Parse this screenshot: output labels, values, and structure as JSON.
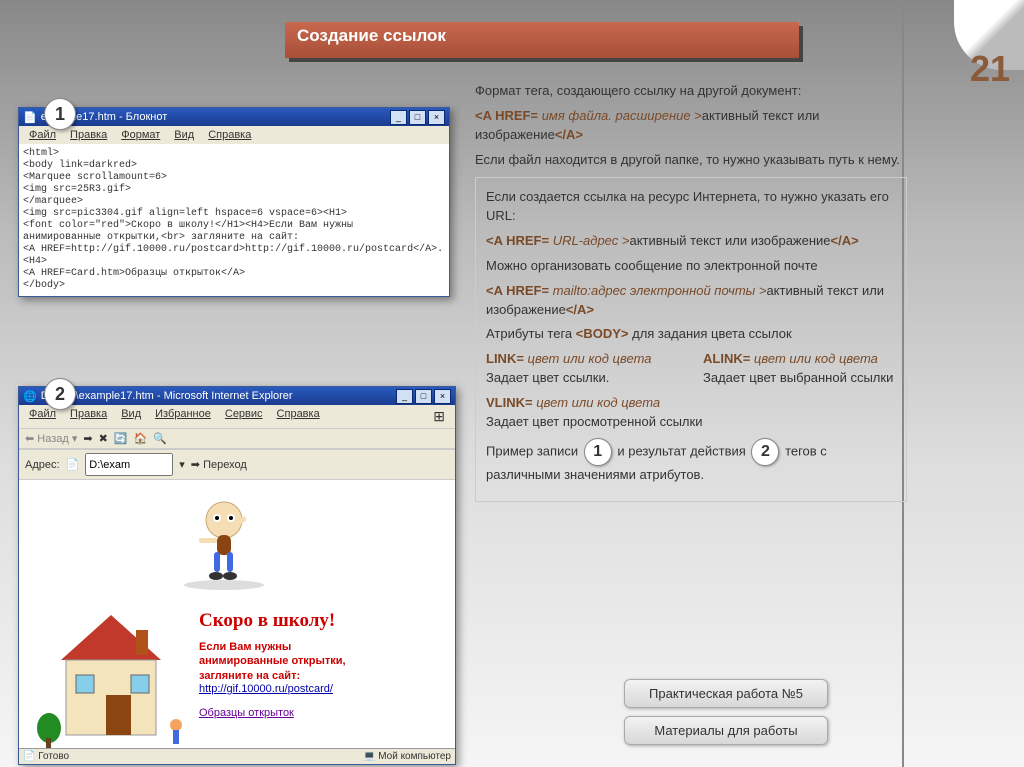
{
  "page_number": "21",
  "title": "Создание ссылок",
  "badge1": "1",
  "badge2": "2",
  "notepad": {
    "title": "example17.htm - Блокнот",
    "menu": [
      "Файл",
      "Правка",
      "Формат",
      "Вид",
      "Справка"
    ],
    "lines": [
      "<html>",
      "<body link=darkred>",
      "<Marquee  scrollamount=6>",
      "<img src=25R3.gif>",
      "</marquee>",
      "<img src=pic3304.gif align=left hspace=6 vspace=6><H1>",
      "<font color=\"red\">Скоро в школу!</H1><H4>Если Вам нужны",
      "анимированные открытки,<br> загляните на сайт:",
      "<A HREF=http://gif.10000.ru/postcard>http://gif.10000.ru/postcard</A>.<H4>",
      "<A HREF=Card.htm>Образцы открыток</A>",
      "</body>"
    ]
  },
  "ie": {
    "title": "D:\\ex...\\example17.htm - Microsoft Internet Explorer",
    "menu": [
      "Файл",
      "Правка",
      "Вид",
      "Избранное",
      "Сервис",
      "Справка"
    ],
    "nav_back": "Назад",
    "addr_label": "Адрес:",
    "addr_value": "D:\\exam",
    "go_label": "Переход",
    "page": {
      "heading": "Скоро в школу!",
      "sub1": "Если Вам нужны",
      "sub2": "анимированные открытки,",
      "sub3": "загляните на сайт:",
      "link1": "http://gif.10000.ru/postcard/",
      "link2": "Образцы открыток"
    },
    "status_left": "Готово",
    "status_right": "Мой компьютер"
  },
  "doc": {
    "p1": "Формат тега, создающего ссылку на другой документ:",
    "fmt1_pre": "<A HREF=",
    "fmt1_mid": " имя файла. расширение >",
    "fmt1_txt": "активный текст или изображение",
    "fmt1_end": "</A>",
    "p2": "Если файл находится в другой папке, то нужно указывать путь к нему.",
    "p3": "Если создается ссылка на ресурс Интернета, то нужно указать его URL:",
    "fmt2_pre": "<A HREF=",
    "fmt2_mid": " URL-адрес >",
    "fmt2_txt": "активный  текст или изображение",
    "fmt2_end": "</A>",
    "p4": "Можно организовать сообщение по электронной почте",
    "fmt3_pre": "<A HREF=",
    "fmt3_mid": " mailto:адрес электронной почты >",
    "fmt3_txt": "активный  текст или изображение",
    "fmt3_end": "</A>",
    "attr_title_a": "Атрибуты тега  ",
    "attr_title_b": "<BODY>",
    "attr_title_c": " для задания цвета ссылок",
    "link_attr": "LINK=",
    "link_val": " цвет или код цвета",
    "link_desc": "Задает цвет ссылки.",
    "alink_attr": "ALINK=",
    "alink_val": " цвет или код цвета",
    "alink_desc": "Задает цвет выбранной ссылки",
    "vlink_attr": "VLINK=",
    "vlink_val": " цвет или код цвета",
    "vlink_desc": "Задает цвет просмотренной ссылки",
    "ex_a": "Пример записи ",
    "ex_b": " и результат действия ",
    "ex_c": "тегов с различными значениями атрибутов."
  },
  "buttons": {
    "b1": "Практическая работа №5",
    "b2": "Материалы для работы"
  }
}
